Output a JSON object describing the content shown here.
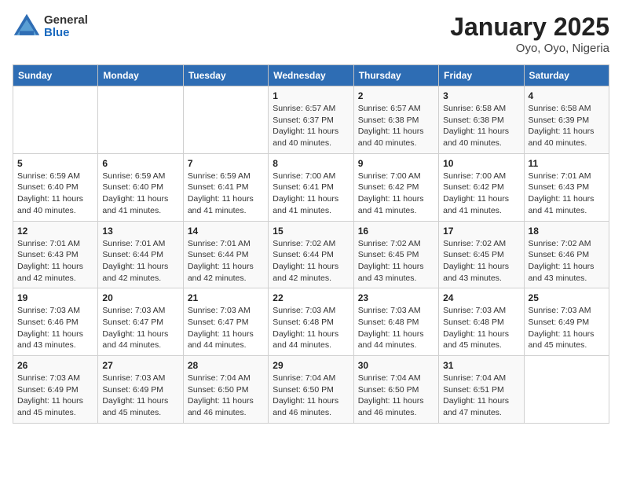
{
  "header": {
    "logo_general": "General",
    "logo_blue": "Blue",
    "title": "January 2025",
    "subtitle": "Oyo, Oyo, Nigeria"
  },
  "days_of_week": [
    "Sunday",
    "Monday",
    "Tuesday",
    "Wednesday",
    "Thursday",
    "Friday",
    "Saturday"
  ],
  "weeks": [
    [
      {
        "day": "",
        "info": ""
      },
      {
        "day": "",
        "info": ""
      },
      {
        "day": "",
        "info": ""
      },
      {
        "day": "1",
        "info": "Sunrise: 6:57 AM\nSunset: 6:37 PM\nDaylight: 11 hours and 40 minutes."
      },
      {
        "day": "2",
        "info": "Sunrise: 6:57 AM\nSunset: 6:38 PM\nDaylight: 11 hours and 40 minutes."
      },
      {
        "day": "3",
        "info": "Sunrise: 6:58 AM\nSunset: 6:38 PM\nDaylight: 11 hours and 40 minutes."
      },
      {
        "day": "4",
        "info": "Sunrise: 6:58 AM\nSunset: 6:39 PM\nDaylight: 11 hours and 40 minutes."
      }
    ],
    [
      {
        "day": "5",
        "info": "Sunrise: 6:59 AM\nSunset: 6:40 PM\nDaylight: 11 hours and 40 minutes."
      },
      {
        "day": "6",
        "info": "Sunrise: 6:59 AM\nSunset: 6:40 PM\nDaylight: 11 hours and 41 minutes."
      },
      {
        "day": "7",
        "info": "Sunrise: 6:59 AM\nSunset: 6:41 PM\nDaylight: 11 hours and 41 minutes."
      },
      {
        "day": "8",
        "info": "Sunrise: 7:00 AM\nSunset: 6:41 PM\nDaylight: 11 hours and 41 minutes."
      },
      {
        "day": "9",
        "info": "Sunrise: 7:00 AM\nSunset: 6:42 PM\nDaylight: 11 hours and 41 minutes."
      },
      {
        "day": "10",
        "info": "Sunrise: 7:00 AM\nSunset: 6:42 PM\nDaylight: 11 hours and 41 minutes."
      },
      {
        "day": "11",
        "info": "Sunrise: 7:01 AM\nSunset: 6:43 PM\nDaylight: 11 hours and 41 minutes."
      }
    ],
    [
      {
        "day": "12",
        "info": "Sunrise: 7:01 AM\nSunset: 6:43 PM\nDaylight: 11 hours and 42 minutes."
      },
      {
        "day": "13",
        "info": "Sunrise: 7:01 AM\nSunset: 6:44 PM\nDaylight: 11 hours and 42 minutes."
      },
      {
        "day": "14",
        "info": "Sunrise: 7:01 AM\nSunset: 6:44 PM\nDaylight: 11 hours and 42 minutes."
      },
      {
        "day": "15",
        "info": "Sunrise: 7:02 AM\nSunset: 6:44 PM\nDaylight: 11 hours and 42 minutes."
      },
      {
        "day": "16",
        "info": "Sunrise: 7:02 AM\nSunset: 6:45 PM\nDaylight: 11 hours and 43 minutes."
      },
      {
        "day": "17",
        "info": "Sunrise: 7:02 AM\nSunset: 6:45 PM\nDaylight: 11 hours and 43 minutes."
      },
      {
        "day": "18",
        "info": "Sunrise: 7:02 AM\nSunset: 6:46 PM\nDaylight: 11 hours and 43 minutes."
      }
    ],
    [
      {
        "day": "19",
        "info": "Sunrise: 7:03 AM\nSunset: 6:46 PM\nDaylight: 11 hours and 43 minutes."
      },
      {
        "day": "20",
        "info": "Sunrise: 7:03 AM\nSunset: 6:47 PM\nDaylight: 11 hours and 44 minutes."
      },
      {
        "day": "21",
        "info": "Sunrise: 7:03 AM\nSunset: 6:47 PM\nDaylight: 11 hours and 44 minutes."
      },
      {
        "day": "22",
        "info": "Sunrise: 7:03 AM\nSunset: 6:48 PM\nDaylight: 11 hours and 44 minutes."
      },
      {
        "day": "23",
        "info": "Sunrise: 7:03 AM\nSunset: 6:48 PM\nDaylight: 11 hours and 44 minutes."
      },
      {
        "day": "24",
        "info": "Sunrise: 7:03 AM\nSunset: 6:48 PM\nDaylight: 11 hours and 45 minutes."
      },
      {
        "day": "25",
        "info": "Sunrise: 7:03 AM\nSunset: 6:49 PM\nDaylight: 11 hours and 45 minutes."
      }
    ],
    [
      {
        "day": "26",
        "info": "Sunrise: 7:03 AM\nSunset: 6:49 PM\nDaylight: 11 hours and 45 minutes."
      },
      {
        "day": "27",
        "info": "Sunrise: 7:03 AM\nSunset: 6:49 PM\nDaylight: 11 hours and 45 minutes."
      },
      {
        "day": "28",
        "info": "Sunrise: 7:04 AM\nSunset: 6:50 PM\nDaylight: 11 hours and 46 minutes."
      },
      {
        "day": "29",
        "info": "Sunrise: 7:04 AM\nSunset: 6:50 PM\nDaylight: 11 hours and 46 minutes."
      },
      {
        "day": "30",
        "info": "Sunrise: 7:04 AM\nSunset: 6:50 PM\nDaylight: 11 hours and 46 minutes."
      },
      {
        "day": "31",
        "info": "Sunrise: 7:04 AM\nSunset: 6:51 PM\nDaylight: 11 hours and 47 minutes."
      },
      {
        "day": "",
        "info": ""
      }
    ]
  ]
}
